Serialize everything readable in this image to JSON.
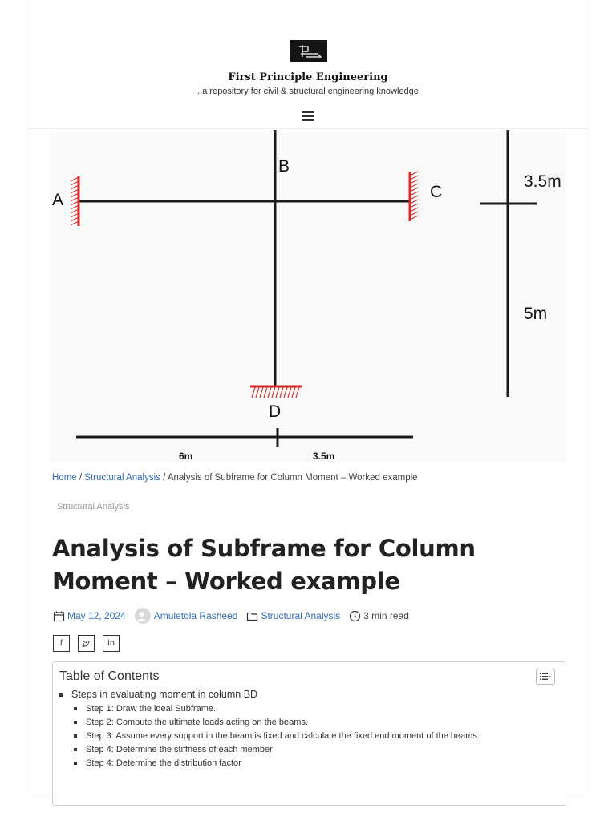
{
  "header": {
    "site_title": "First Principle Engineering",
    "tagline": "..a repository for civil & structural engineering knowledge"
  },
  "figure": {
    "labels": {
      "a": "A",
      "b": "B",
      "c": "C",
      "d": "D"
    },
    "dims": {
      "top_dim": "3.5m",
      "side_dim": "5m",
      "left_span": "6m",
      "right_span": "3.5m"
    },
    "support_color": "#d42a2a"
  },
  "breadcrumb": {
    "home": "Home",
    "sep": " / ",
    "category": "Structural Analysis",
    "current": "Analysis of Subframe for Column Moment – Worked example"
  },
  "category_tag": "Structural Analysis",
  "post": {
    "title": "Analysis of Subframe for Column Moment – Worked example",
    "date": "May 12, 2024",
    "author": "Amuletola Rasheed",
    "category": "Structural Analysis",
    "read_time": "3 min read"
  },
  "share": {
    "facebook": "f",
    "twitter": "t",
    "linkedin": "in"
  },
  "toc": {
    "title": "Table of Contents",
    "items": [
      {
        "label": "Steps in evaluating moment in column BD",
        "children": [
          "Step 1: Draw the ideal Subframe.",
          "Step 2: Compute the ultimate loads acting on the beams.",
          "Step 3:  Assume every support in the beam is fixed and calculate the fixed end moment of the beams.",
          "Step 4: Determine the stiffness of each member",
          "Step 4: Determine the distribution factor"
        ]
      }
    ]
  },
  "colors": {
    "link": "#2f6bbf",
    "text": "#222222"
  }
}
